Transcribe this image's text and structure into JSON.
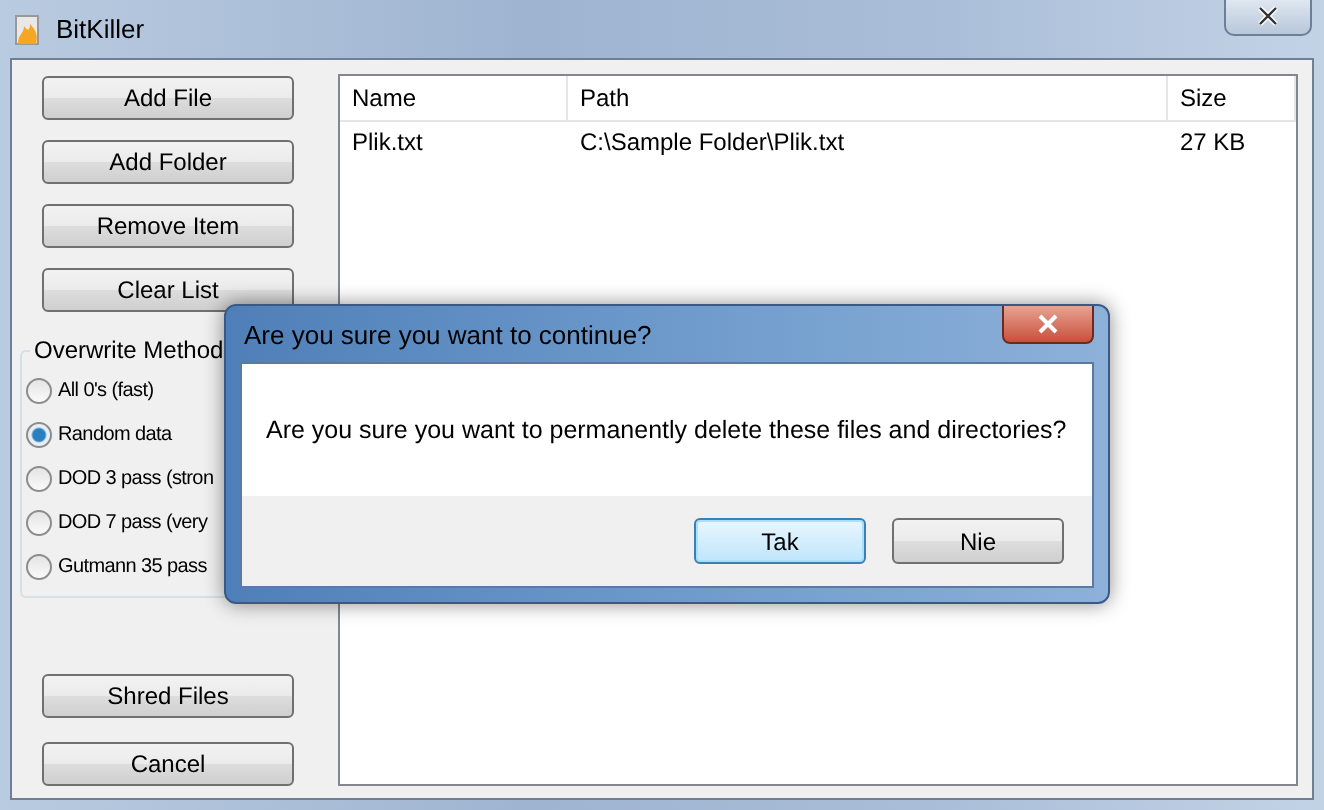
{
  "window": {
    "title": "BitKiller"
  },
  "buttons": [
    "Add File",
    "Add Folder",
    "Remove Item",
    "Clear List"
  ],
  "overwrite_method": {
    "title": "Overwrite Method",
    "options": [
      {
        "label": "All 0's (fast)",
        "selected": false
      },
      {
        "label": "Random data",
        "selected": true
      },
      {
        "label": "DOD 3 pass (stron",
        "selected": false
      },
      {
        "label": "DOD 7 pass (very",
        "selected": false
      },
      {
        "label": "Gutmann 35 pass",
        "selected": false
      }
    ]
  },
  "bottom_buttons": [
    "Shred Files",
    "Cancel"
  ],
  "table": {
    "columns": [
      "Name",
      "Path",
      "Size"
    ],
    "rows": [
      [
        "Plik.txt",
        "C:\\Sample Folder\\Plik.txt",
        "27 KB"
      ]
    ]
  },
  "dialog": {
    "title": "Are you sure you want to continue?",
    "message": "Are you sure you want to permanently delete these files and directories?",
    "buttons": [
      {
        "label": "Tak",
        "focused": true
      },
      {
        "label": "Nie",
        "focused": false
      }
    ]
  }
}
